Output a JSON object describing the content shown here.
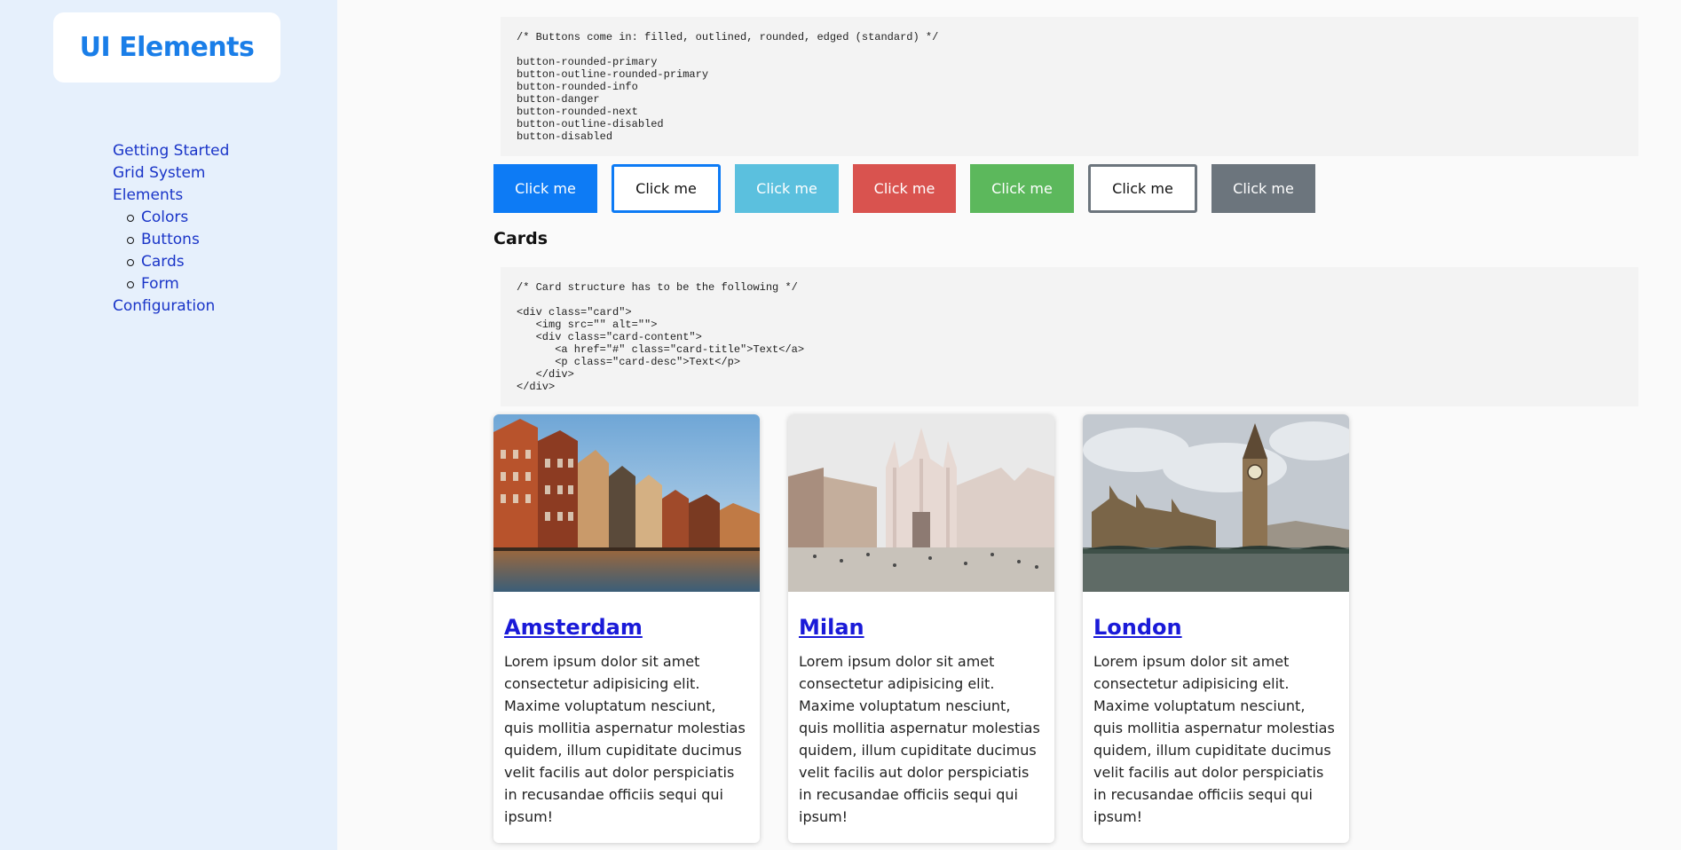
{
  "sidebar": {
    "logo": "UI Elements",
    "nav": [
      {
        "label": "Getting Started"
      },
      {
        "label": "Grid System"
      },
      {
        "label": "Elements"
      },
      {
        "label": "Colors"
      },
      {
        "label": "Buttons"
      },
      {
        "label": "Cards"
      },
      {
        "label": "Form"
      },
      {
        "label": "Configuration"
      }
    ]
  },
  "buttons_code": "/* Buttons come in: filled, outlined, rounded, edged (standard) */\n\nbutton-rounded-primary\nbutton-outline-rounded-primary\nbutton-rounded-info\nbutton-danger\nbutton-rounded-next\nbutton-outline-disabled\nbutton-disabled",
  "buttons": [
    {
      "label": "Click me",
      "style": "filled",
      "color": "#0d7bf5"
    },
    {
      "label": "Click me",
      "style": "outline",
      "color": "#0d7bf5"
    },
    {
      "label": "Click me",
      "style": "filled",
      "color": "#5bc0de"
    },
    {
      "label": "Click me",
      "style": "filled",
      "color": "#d9534f"
    },
    {
      "label": "Click me",
      "style": "filled",
      "color": "#5cb85c"
    },
    {
      "label": "Click me",
      "style": "outline",
      "color": "#6c757d"
    },
    {
      "label": "Click me",
      "style": "filled",
      "color": "#6c757d"
    }
  ],
  "cards_title": "Cards",
  "cards_code": "/* Card structure has to be the following */\n\n<div class=\"card\">\n   <img src=\"\" alt=\"\">\n   <div class=\"card-content\">\n      <a href=\"#\" class=\"card-title\">Text</a>\n      <p class=\"card-desc\">Text</p>\n   </div>\n</div>",
  "cards": [
    {
      "title": "Amsterdam",
      "desc": "Lorem ipsum dolor sit amet consectetur adipisicing elit. Maxime voluptatum nesciunt, quis mollitia aspernatur molestias quidem, illum cupiditate ducimus velit facilis aut dolor perspiciatis in recusandae officiis sequi qui ipsum!"
    },
    {
      "title": "Milan",
      "desc": "Lorem ipsum dolor sit amet consectetur adipisicing elit. Maxime voluptatum nesciunt, quis mollitia aspernatur molestias quidem, illum cupiditate ducimus velit facilis aut dolor perspiciatis in recusandae officiis sequi qui ipsum!"
    },
    {
      "title": "London",
      "desc": "Lorem ipsum dolor sit amet consectetur adipisicing elit. Maxime voluptatum nesciunt, quis mollitia aspernatur molestias quidem, illum cupiditate ducimus velit facilis aut dolor perspiciatis in recusandae officiis sequi qui ipsum!"
    }
  ]
}
